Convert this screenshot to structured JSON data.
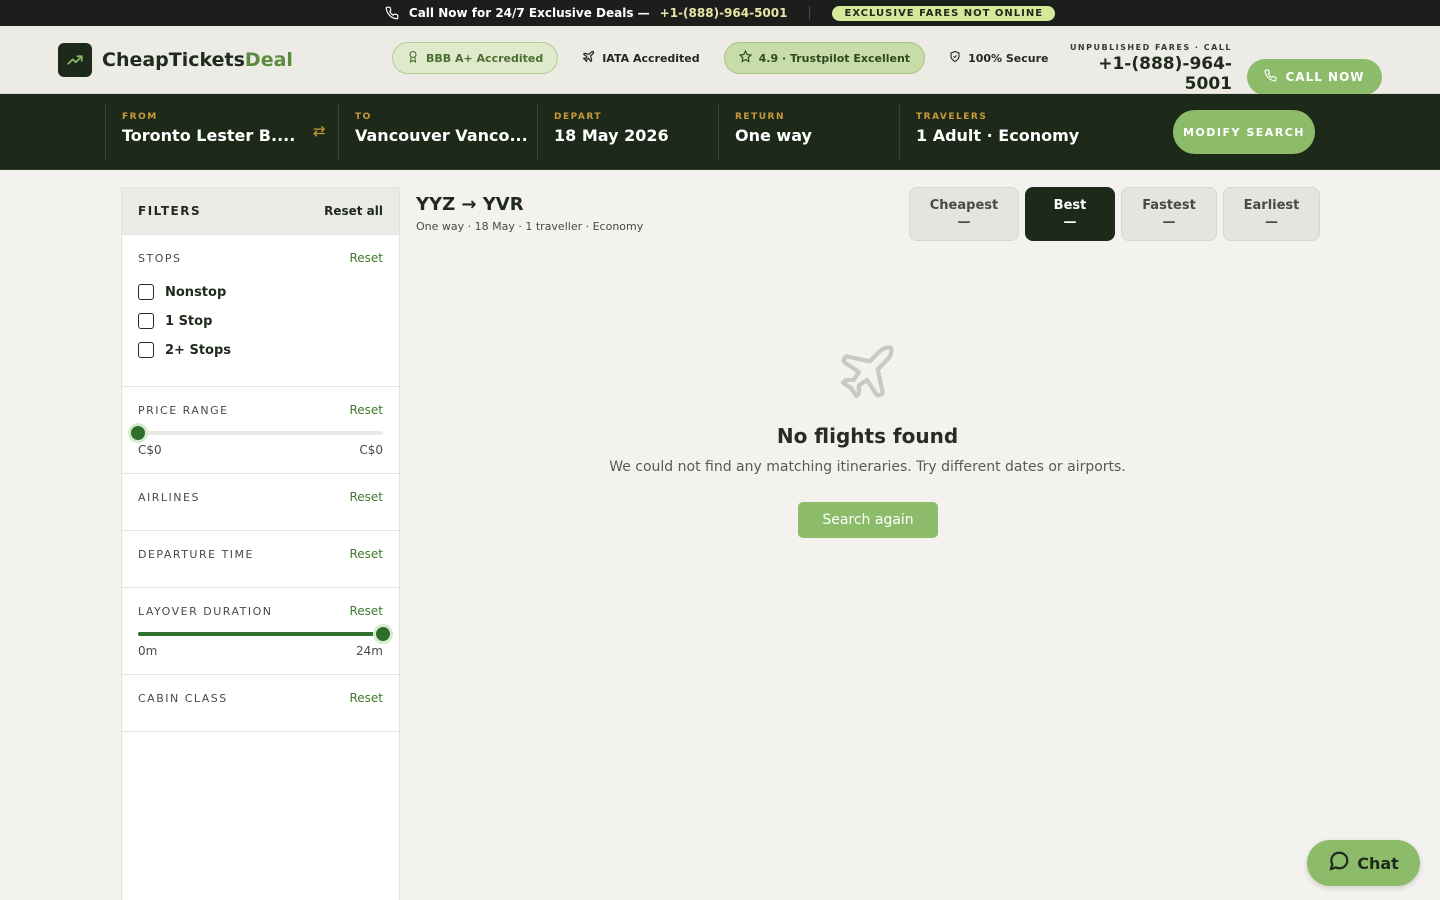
{
  "topbar": {
    "call_text": "Call Now for 24/7 Exclusive Deals —",
    "phone": "+1-(888)-964-5001",
    "badge": "EXCLUSIVE FARES NOT ONLINE"
  },
  "header": {
    "brand_main": "CheapTickets",
    "brand_accent": "Deal",
    "trust": {
      "bbb": "BBB A+ Accredited",
      "iata": "IATA Accredited",
      "trustpilot": "4.9 · Trustpilot Excellent",
      "secure": "100% Secure"
    },
    "call_label": "UNPUBLISHED FARES · CALL",
    "call_number": "+1-(888)-964-5001",
    "call_button": "CALL NOW"
  },
  "search": {
    "from_label": "FROM",
    "from_value": "Toronto Lester B....",
    "swap_icon": "⇄",
    "to_label": "TO",
    "to_value": "Vancouver Vanco...",
    "depart_label": "DEPART",
    "depart_value": "18 May 2026",
    "return_label": "RETURN",
    "return_value": "One way",
    "travelers_label": "TRAVELERS",
    "travelers_value": "1 Adult · Economy",
    "modify_button": "MODIFY SEARCH"
  },
  "filters": {
    "title": "FILTERS",
    "reset_all": "Reset all",
    "reset": "Reset",
    "stops": {
      "title": "STOPS",
      "options": [
        "Nonstop",
        "1 Stop",
        "2+ Stops"
      ]
    },
    "price": {
      "title": "PRICE RANGE",
      "min_label": "C$0",
      "max_label": "C$0",
      "level": 0
    },
    "airlines": {
      "title": "AIRLINES"
    },
    "departure_time": {
      "title": "DEPARTURE TIME"
    },
    "layover": {
      "title": "LAYOVER DURATION",
      "min_label": "0m",
      "max_label": "24m",
      "level": 1
    },
    "cabin": {
      "title": "CABIN CLASS"
    }
  },
  "results": {
    "route": "YYZ → YVR",
    "summary": "One way · 18 May · 1 traveller · Economy",
    "sort_tabs": [
      {
        "label": "Cheapest",
        "value": "—"
      },
      {
        "label": "Best",
        "value": "—",
        "active": true
      },
      {
        "label": "Fastest",
        "value": "—"
      },
      {
        "label": "Earliest",
        "value": "—"
      }
    ],
    "empty_title": "No flights found",
    "empty_desc": "We could not find any matching itineraries. Try different dates or airports.",
    "search_again": "Search again"
  },
  "chat": {
    "label": "Chat"
  },
  "colors": {
    "brand_dark": "#1d2a1a",
    "brand_green": "#8cbc6a",
    "accent_gold": "#c99a3a",
    "slider_green": "#2f6e2b"
  },
  "icons": [
    "phone-icon",
    "trend-up-icon",
    "award-icon",
    "plane-icon",
    "star-icon",
    "shield-icon",
    "swap-icon",
    "chat-bubble-icon"
  ]
}
